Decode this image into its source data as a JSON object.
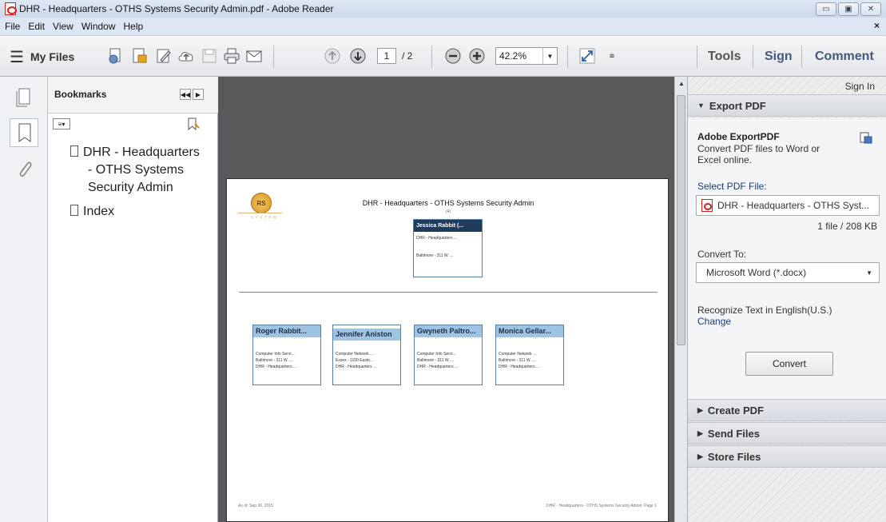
{
  "window": {
    "title": "DHR - Headquarters - OTHS Systems Security Admin.pdf - Adobe Reader",
    "controls": [
      "▭",
      "▣",
      "✕"
    ],
    "menu_close": "×"
  },
  "menu": [
    "File",
    "Edit",
    "View",
    "Window",
    "Help"
  ],
  "toolbar": {
    "my_files": "My Files",
    "page_current": "1",
    "page_total": "/ 2",
    "zoom": "42.2%",
    "right_tabs": [
      "Tools",
      "Sign",
      "Comment"
    ]
  },
  "bookmarks": {
    "title": "Bookmarks",
    "items": [
      "DHR - Headquarters - OTHS Systems Security Admin",
      "Index"
    ],
    "item_lines": [
      "DHR - Headquarters",
      "- OTHS Systems",
      "Security Admin"
    ]
  },
  "document": {
    "title": "DHR - Headquarters - OTHS Systems Security Admin",
    "count": "(4)",
    "logo_text": "S Y S T E M",
    "top_card": {
      "name": "Jessica Rabbit (...",
      "lines": [
        "DHR - Headquarters ...",
        "Baltimore - 311 W. ..."
      ]
    },
    "cards": [
      {
        "name": "Roger Rabbit...",
        "lines": [
          "Computer Info Servi...",
          "Baltimore - 311 W. ...",
          "DHR - Headquarters ..."
        ]
      },
      {
        "name": "Jennifer Aniston",
        "lines": [
          "Computer Network ...",
          "Essex - 1100 Easte...",
          "DHR - Headquarters ..."
        ]
      },
      {
        "name": "Gwyneth Paltro...",
        "lines": [
          "Computer Info Servi...",
          "Baltimore - 311 W. ...",
          "DHR - Headquarters ..."
        ]
      },
      {
        "name": "Monica Gellar...",
        "lines": [
          "Computer Network ...",
          "Baltimore - 311 W. ...",
          "DHR - Headquarters ..."
        ]
      }
    ],
    "footer_left": "As of: Sep 30, 2015",
    "footer_right": "DHR - Headquarters - OTHS Systems Security Admin: Page 1"
  },
  "right_pane": {
    "sign_in": "Sign In",
    "export_header": "Export PDF",
    "export_title": "Adobe ExportPDF",
    "export_desc": "Convert PDF files to Word or Excel online.",
    "select_label": "Select PDF File:",
    "file_name": "DHR - Headquarters - OTHS Syst...",
    "file_size": "1 file / 208 KB",
    "convert_to_label": "Convert To:",
    "convert_to_value": "Microsoft Word (*.docx)",
    "recognize": "Recognize Text in English(U.S.)",
    "change": "Change",
    "convert_button": "Convert",
    "sections": [
      "Create PDF",
      "Send Files",
      "Store Files"
    ]
  }
}
